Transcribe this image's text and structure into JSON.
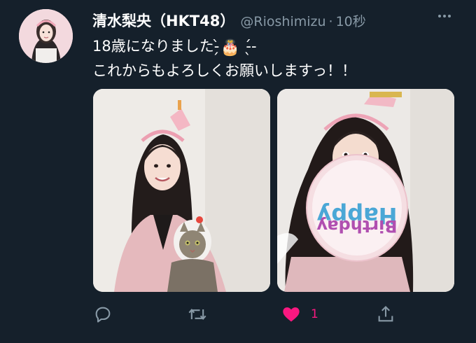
{
  "tweet": {
    "author": {
      "display_name": "清水梨央（HKT48）",
      "handle": "@Rioshimizu",
      "avatar_icon": "profile-photo"
    },
    "separator": "·",
    "timestamp": "10秒",
    "text_line1_before": "18歳になりました-̗̀",
    "emoji": "🎂",
    "text_line1_after": " -̖́-",
    "text_line2": "これからもよろしくお願いしますっ！！",
    "media": [
      {
        "icon": "photo-girl-with-cat"
      },
      {
        "icon": "photo-girl-with-balloon",
        "balloon_text": "Happy Birthday"
      }
    ],
    "actions": {
      "reply_icon": "reply-icon",
      "retweet_icon": "retweet-icon",
      "like_icon": "heart-icon",
      "like_count": "1",
      "share_icon": "share-icon"
    }
  },
  "colors": {
    "background": "#15202b",
    "secondary_text": "#8899a6",
    "like_active": "#f91880"
  }
}
